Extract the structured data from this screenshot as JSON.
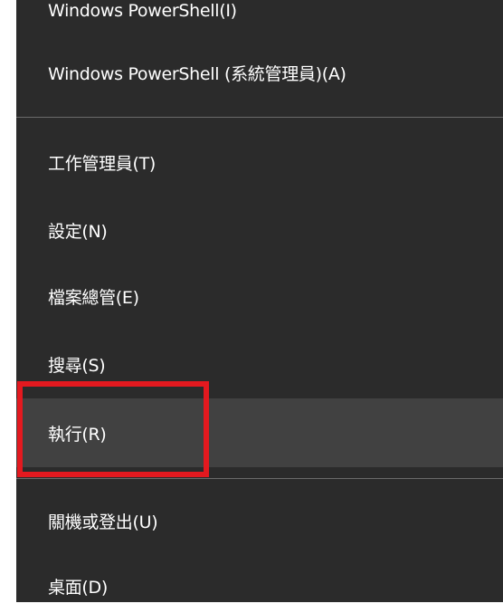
{
  "menu": {
    "items": [
      {
        "label": "Windows PowerShell(I)"
      },
      {
        "label": "Windows PowerShell (系統管理員)(A)"
      },
      {
        "label": "工作管理員(T)"
      },
      {
        "label": "設定(N)"
      },
      {
        "label": "檔案總管(E)"
      },
      {
        "label": "搜尋(S)"
      },
      {
        "label": "執行(R)"
      },
      {
        "label": "關機或登出(U)"
      },
      {
        "label": "桌面(D)"
      }
    ]
  },
  "colors": {
    "menu_background": "#2b2b2b",
    "hover_background": "#414141",
    "highlight_border": "#e3191f",
    "text": "#ffffff"
  }
}
